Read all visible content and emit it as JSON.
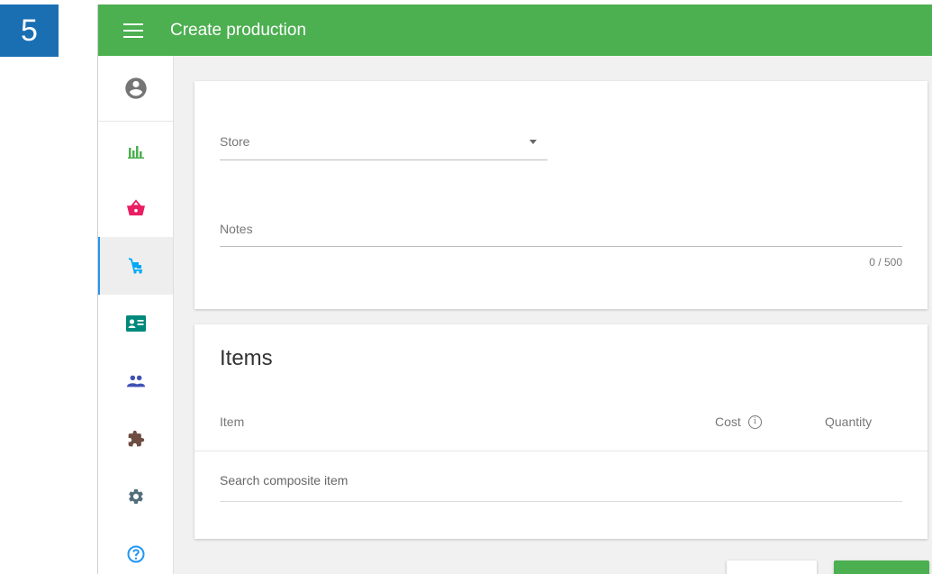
{
  "step": {
    "number": "5"
  },
  "header": {
    "title": "Create production",
    "menu_icon": "hamburger-menu-icon"
  },
  "sidebar": {
    "items": [
      {
        "icon": "account-circle-icon",
        "color": "#757575"
      },
      {
        "icon": "bar-chart-icon",
        "color": "#4caf50"
      },
      {
        "icon": "shopping-basket-icon",
        "color": "#e91e63"
      },
      {
        "icon": "inventory-cart-icon",
        "color": "#03a9f4",
        "active": true
      },
      {
        "icon": "contact-card-icon",
        "color": "#00897b"
      },
      {
        "icon": "people-icon",
        "color": "#3f51b5"
      },
      {
        "icon": "puzzle-icon",
        "color": "#6d4c41"
      },
      {
        "icon": "settings-gear-icon",
        "color": "#546e7a"
      },
      {
        "icon": "help-icon",
        "color": "#2196f3"
      }
    ]
  },
  "form": {
    "store_label": "Store",
    "notes_label": "Notes",
    "notes_counter": "0 / 500"
  },
  "items": {
    "title": "Items",
    "columns": {
      "item": "Item",
      "cost": "Cost",
      "quantity": "Quantity"
    },
    "search_placeholder": "Search composite item"
  },
  "colors": {
    "accent": "#4caf50",
    "step_badge": "#1a6fb3",
    "active_indicator": "#2196f3"
  }
}
